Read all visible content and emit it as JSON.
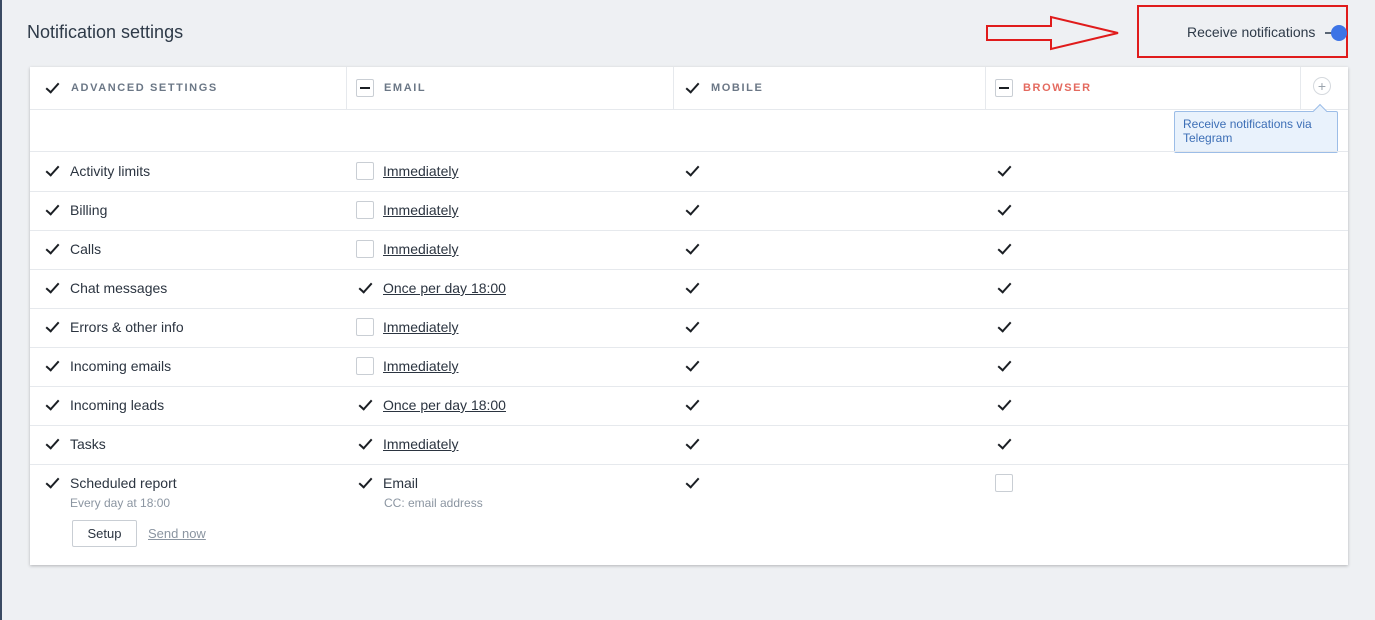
{
  "page": {
    "title": "Notification settings"
  },
  "receive": {
    "label": "Receive notifications",
    "enabled": true
  },
  "header": {
    "advanced": "ADVANCED SETTINGS",
    "email": "EMAIL",
    "mobile": "MOBILE",
    "browser": "BROWSER",
    "add_tooltip": "Receive notifications via Telegram"
  },
  "rows": [
    {
      "label": "Activity limits",
      "email_checked": false,
      "email_freq": "Immediately",
      "mobile": true,
      "browser": true
    },
    {
      "label": "Billing",
      "email_checked": false,
      "email_freq": "Immediately",
      "mobile": true,
      "browser": true
    },
    {
      "label": "Calls",
      "email_checked": false,
      "email_freq": "Immediately",
      "mobile": true,
      "browser": true
    },
    {
      "label": "Chat messages",
      "email_checked": true,
      "email_freq": "Once per day 18:00",
      "mobile": true,
      "browser": true
    },
    {
      "label": "Errors & other info",
      "email_checked": false,
      "email_freq": "Immediately",
      "mobile": true,
      "browser": true
    },
    {
      "label": "Incoming emails",
      "email_checked": false,
      "email_freq": "Immediately",
      "mobile": true,
      "browser": true
    },
    {
      "label": "Incoming leads",
      "email_checked": true,
      "email_freq": "Once per day 18:00",
      "mobile": true,
      "browser": true
    },
    {
      "label": "Tasks",
      "email_checked": true,
      "email_freq": "Immediately",
      "mobile": true,
      "browser": true
    }
  ],
  "report": {
    "label": "Scheduled report",
    "schedule": "Every day at 18:00",
    "email_label": "Email",
    "cc": "CC:  email address",
    "mobile": true,
    "browser": false,
    "setup": "Setup",
    "send_now": "Send now"
  },
  "colors": {
    "toggle_on": "#3d74e6",
    "highlight": "#e01b1b",
    "browser_header": "#e46a5f"
  }
}
